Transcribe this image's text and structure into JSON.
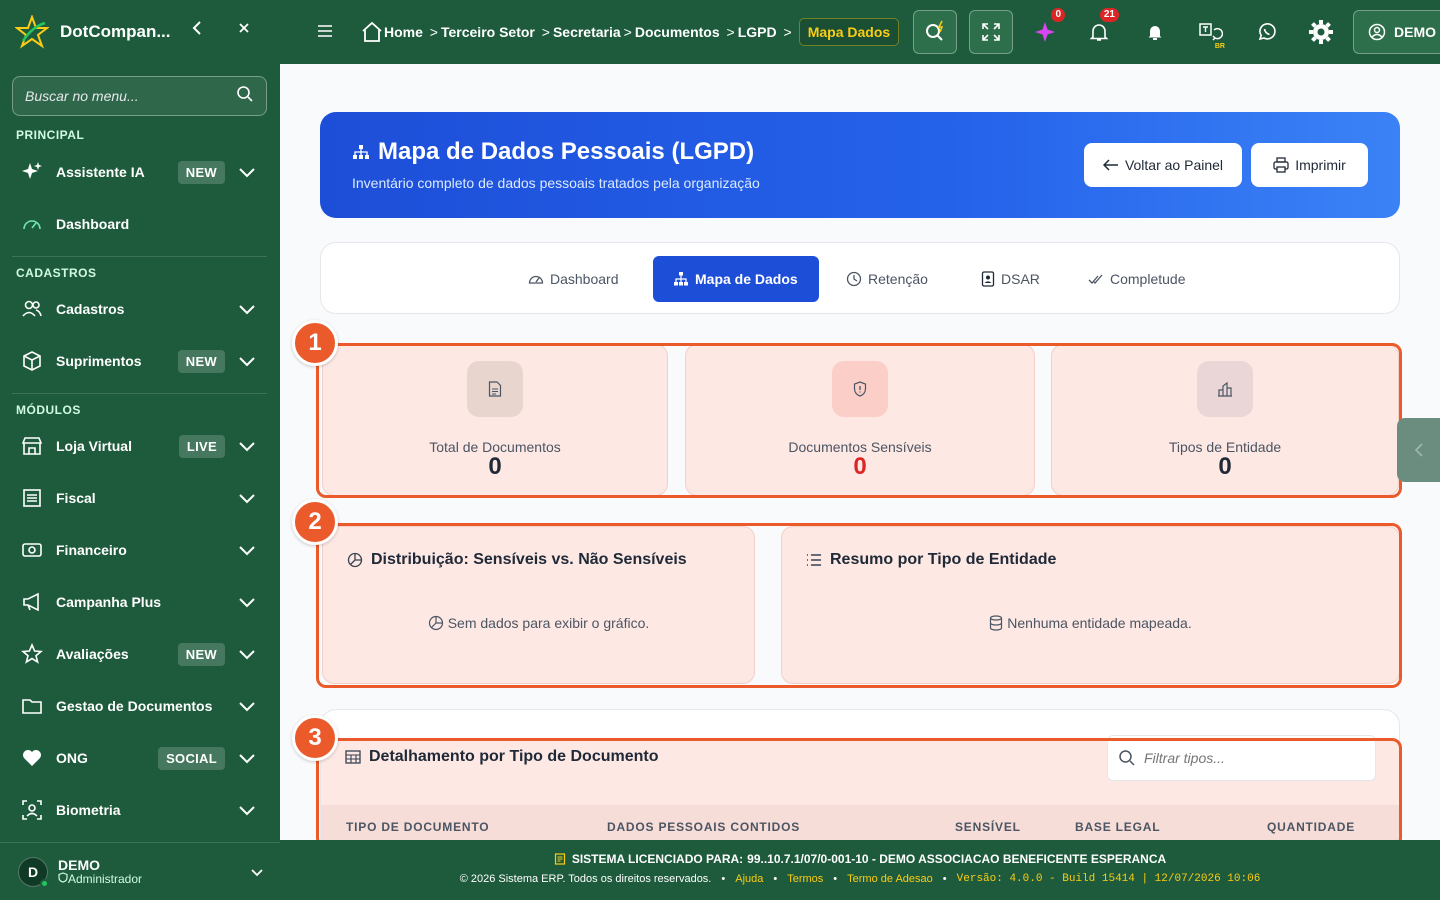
{
  "brand": {
    "name": "DotCompan..."
  },
  "sidebar": {
    "search_placeholder": "Buscar no menu...",
    "sections": {
      "principal": "PRINCIPAL",
      "cadastros": "CADASTROS",
      "modulos": "MÓDULOS"
    },
    "items": [
      {
        "label": "Assistente IA",
        "badge": "NEW",
        "icon": "sparkles-icon"
      },
      {
        "label": "Dashboard",
        "badge": "",
        "icon": "gauge-icon"
      },
      {
        "label": "Cadastros",
        "badge": "",
        "icon": "users-icon"
      },
      {
        "label": "Suprimentos",
        "badge": "NEW",
        "icon": "box-icon"
      },
      {
        "label": "Loja Virtual",
        "badge": "LIVE",
        "icon": "store-icon"
      },
      {
        "label": "Fiscal",
        "badge": "",
        "icon": "receipt-icon"
      },
      {
        "label": "Financeiro",
        "badge": "",
        "icon": "money-icon"
      },
      {
        "label": "Campanha Plus",
        "badge": "",
        "icon": "megaphone-icon"
      },
      {
        "label": "Avaliações",
        "badge": "NEW",
        "icon": "star-icon"
      },
      {
        "label": "Gestao de Documentos",
        "badge": "",
        "icon": "folder-icon"
      },
      {
        "label": "ONG",
        "badge": "SOCIAL",
        "icon": "heart-icon"
      },
      {
        "label": "Biometria",
        "badge": "",
        "icon": "face-scan-icon"
      }
    ],
    "user": {
      "initial": "D",
      "name": "DEMO",
      "role": "Administrador"
    }
  },
  "topbar": {
    "breadcrumbs": [
      "Home",
      "Terceiro Setor",
      "Secretaria",
      "Documentos",
      "LGPD"
    ],
    "active_crumb": "Mapa Dados",
    "ai_badge": "0",
    "notif_badge": "21",
    "lang": "BR",
    "user_label": "DEMO"
  },
  "hero": {
    "title": "Mapa de Dados Pessoais (LGPD)",
    "subtitle": "Inventário completo de dados pessoais tratados pela organização",
    "back_label": "Voltar ao Painel",
    "print_label": "Imprimir"
  },
  "tabs": [
    {
      "label": "Dashboard",
      "active": false
    },
    {
      "label": "Mapa de Dados",
      "active": true
    },
    {
      "label": "Retenção",
      "active": false
    },
    {
      "label": "DSAR",
      "active": false
    },
    {
      "label": "Completude",
      "active": false
    }
  ],
  "stats": [
    {
      "label": "Total de Documentos",
      "value": "0",
      "color": "#1f2937"
    },
    {
      "label": "Documentos Sensíveis",
      "value": "0",
      "color": "#dc2626"
    },
    {
      "label": "Tipos de Entidade",
      "value": "0",
      "color": "#1f2937"
    }
  ],
  "panels": {
    "distribution": {
      "title": "Distribuição: Sensíveis vs. Não Sensíveis",
      "empty": "Sem dados para exibir o gráfico."
    },
    "summary": {
      "title": "Resumo por Tipo de Entidade",
      "empty": "Nenhuma entidade mapeada."
    }
  },
  "table": {
    "title": "Detalhamento por Tipo de Documento",
    "filter_placeholder": "Filtrar tipos...",
    "columns": [
      "TIPO DE DOCUMENTO",
      "DADOS PESSOAIS CONTIDOS",
      "SENSÍVEL",
      "BASE LEGAL",
      "QUANTIDADE"
    ]
  },
  "annotations": [
    "1",
    "2",
    "3"
  ],
  "footer": {
    "license_prefix": "SISTEMA LICENCIADO PARA:",
    "license_value": "99..10.7.1/07/0-001-10 - DEMO ASSOCIACAO BENEFICENTE ESPERANCA",
    "copyright": "© 2026 Sistema ERP. Todos os direitos reservados.",
    "links": [
      "Ajuda",
      "Termos",
      "Termo de Adesao"
    ],
    "version": "Versão: 4.0.0 - Build 15414 | 12/07/2026 10:06"
  },
  "colors": {
    "sidebar": "#1e5b3c",
    "accent": "#1d4ed8",
    "highlight": "#ea5a2b",
    "gold": "#facc15"
  }
}
